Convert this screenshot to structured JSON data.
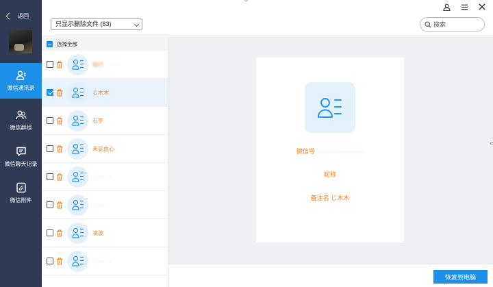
{
  "sidebar": {
    "back_label": "返回",
    "items": [
      {
        "label": "微信通讯录",
        "icon": "contacts-icon",
        "active": true
      },
      {
        "label": "微信群组",
        "icon": "group-icon",
        "active": false
      },
      {
        "label": "微信聊天记录",
        "icon": "chat-icon",
        "active": false
      },
      {
        "label": "微信附件",
        "icon": "attachment-icon",
        "active": false
      }
    ]
  },
  "toolbar": {
    "filter_value": "只显示删除文件 (83)",
    "search_placeholder": "搜索",
    "window_buttons": [
      "user-icon",
      "menu-icon",
      "close-icon"
    ]
  },
  "list": {
    "select_all_label": "选择全部",
    "contacts": [
      {
        "name": "银行 · · · · · ",
        "checked": false,
        "selected": false,
        "blurred": true
      },
      {
        "name": "じ木木",
        "checked": true,
        "selected": true,
        "blurred": false
      },
      {
        "name": "石宇",
        "checked": false,
        "selected": false,
        "blurred": false
      },
      {
        "name": "未妥由心",
        "checked": false,
        "selected": false,
        "blurred": false
      },
      {
        "name": "· · · · · ·",
        "checked": false,
        "selected": false,
        "blurred": true
      },
      {
        "name": "· · · · ·",
        "checked": false,
        "selected": false,
        "blurred": true
      },
      {
        "name": "凌波",
        "checked": false,
        "selected": false,
        "blurred": false
      },
      {
        "name": "· · · · · ·",
        "checked": false,
        "selected": false,
        "blurred": true
      }
    ]
  },
  "detail": {
    "wechat_id_label": "微信号",
    "wechat_id_value": " · · · · · · · · · · · · ·",
    "nickname_label": "昵称",
    "remark_label": "备注名",
    "remark_value": "じ木木"
  },
  "footer": {
    "restore_label": "恢复到电脑"
  },
  "colors": {
    "sidebar_bg": "#2f3a55",
    "accent": "#1e8fe6",
    "name_orange": "#f07e1e"
  }
}
